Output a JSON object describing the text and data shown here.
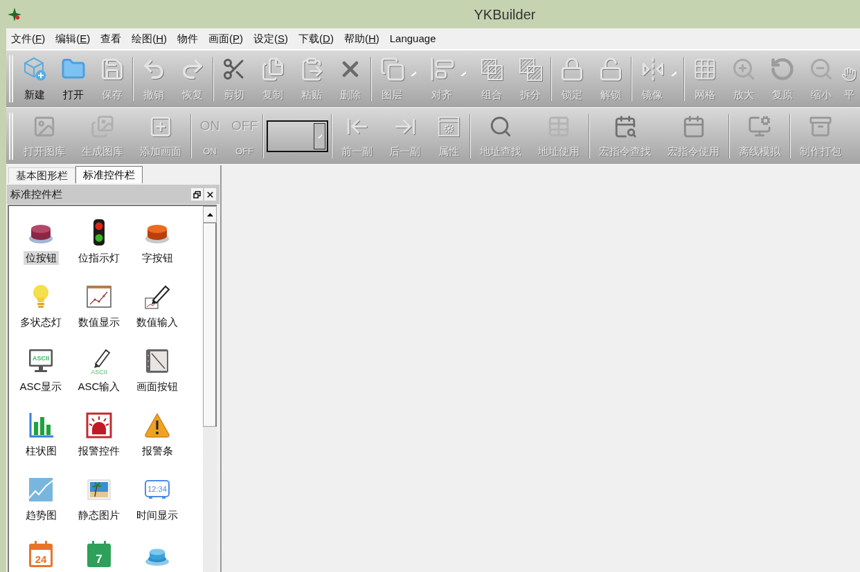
{
  "window": {
    "title": "YKBuilder"
  },
  "menu": [
    {
      "label": "文件(F)",
      "access_key": true
    },
    {
      "label": "编辑(E)",
      "access_key": true
    },
    {
      "label": "查看",
      "access_key": false
    },
    {
      "label": "绘图(H)",
      "access_key": true
    },
    {
      "label": "物件",
      "access_key": false
    },
    {
      "label": "画面(P)",
      "access_key": true
    },
    {
      "label": "设定(S)",
      "access_key": true
    },
    {
      "label": "下载(D)",
      "access_key": true
    },
    {
      "label": "帮助(H)",
      "access_key": true
    },
    {
      "label": "Language",
      "access_key": false
    }
  ],
  "toolbar_1": [
    [
      {
        "label": "新建",
        "disabled": false,
        "dropdown": false
      },
      {
        "label": "打开",
        "disabled": false,
        "dropdown": false
      },
      {
        "label": "保存",
        "disabled": true,
        "dropdown": false
      }
    ],
    [
      {
        "label": "撤销",
        "disabled": true,
        "dropdown": false
      },
      {
        "label": "恢复",
        "disabled": true,
        "dropdown": false
      }
    ],
    [
      {
        "label": "剪切",
        "disabled": true,
        "dropdown": false
      },
      {
        "label": "复制",
        "disabled": true,
        "dropdown": false
      },
      {
        "label": "粘贴",
        "disabled": true,
        "dropdown": false
      },
      {
        "label": "删除",
        "disabled": true,
        "dropdown": false
      }
    ],
    [
      {
        "label": "图层",
        "disabled": true,
        "dropdown": true
      },
      {
        "label": "对齐",
        "disabled": true,
        "dropdown": true
      },
      {
        "label": "组合",
        "disabled": true,
        "dropdown": false
      },
      {
        "label": "拆分",
        "disabled": true,
        "dropdown": false
      }
    ],
    [
      {
        "label": "锁定",
        "disabled": true,
        "dropdown": false
      },
      {
        "label": "解锁",
        "disabled": true,
        "dropdown": false
      }
    ],
    [
      {
        "label": "镜像",
        "disabled": true,
        "dropdown": true
      }
    ],
    [
      {
        "label": "网格",
        "disabled": true,
        "dropdown": false
      },
      {
        "label": "放大",
        "disabled": true,
        "dropdown": false
      },
      {
        "label": "复原",
        "disabled": true,
        "dropdown": false
      },
      {
        "label": "缩小",
        "disabled": true,
        "dropdown": false
      },
      {
        "label": "平",
        "disabled": true,
        "dropdown": false
      }
    ]
  ],
  "toolbar_2": [
    [
      {
        "kind": "button",
        "label": "打开图库",
        "disabled": true
      },
      {
        "kind": "button",
        "label": "生成图库",
        "disabled": true
      },
      {
        "kind": "button",
        "label": "添加画面",
        "disabled": true
      }
    ],
    [
      {
        "kind": "glyph",
        "icon_text": "ON",
        "label": "ON",
        "disabled": true
      },
      {
        "kind": "glyph",
        "icon_text": "OFF",
        "label": "OFF",
        "disabled": true
      }
    ],
    [
      {
        "kind": "combo"
      }
    ],
    [
      {
        "kind": "button",
        "label": "前一副",
        "disabled": true
      },
      {
        "kind": "button",
        "label": "后一副",
        "disabled": true
      },
      {
        "kind": "button",
        "label": "属性",
        "disabled": true
      }
    ],
    [
      {
        "kind": "button",
        "label": "地址查找",
        "disabled": true
      },
      {
        "kind": "button",
        "label": "地址使用",
        "disabled": true
      }
    ],
    [
      {
        "kind": "button",
        "label": "宏指令查找",
        "disabled": true
      },
      {
        "kind": "button",
        "label": "宏指令使用",
        "disabled": true
      }
    ],
    [
      {
        "kind": "button",
        "label": "离线模拟",
        "disabled": true
      }
    ],
    [
      {
        "kind": "button",
        "label": "制作打包",
        "disabled": true
      }
    ]
  ],
  "left_panel": {
    "tabs": [
      {
        "label": "基本图形栏",
        "selected": false
      },
      {
        "label": "标准控件栏",
        "selected": true
      }
    ],
    "title": "标准控件栏",
    "items": [
      {
        "label": "位按钮",
        "selected": true
      },
      {
        "label": "位指示灯",
        "selected": false
      },
      {
        "label": "字按钮",
        "selected": false
      },
      {
        "label": "多状态灯",
        "selected": false
      },
      {
        "label": "数值显示",
        "selected": false
      },
      {
        "label": "数值输入",
        "selected": false
      },
      {
        "label": "ASC显示",
        "icon_text": "ASCII",
        "selected": false
      },
      {
        "label": "ASC输入",
        "icon_text": "ASCII",
        "selected": false
      },
      {
        "label": "画面按钮",
        "selected": false
      },
      {
        "label": "柱状图",
        "selected": false
      },
      {
        "label": "报警控件",
        "selected": false
      },
      {
        "label": "报警条",
        "selected": false
      },
      {
        "label": "趋势图",
        "selected": false
      },
      {
        "label": "静态图片",
        "selected": false
      },
      {
        "label": "时间显示",
        "icon_text": "12:34",
        "selected": false
      },
      {
        "icon_text": "24",
        "selected": false
      },
      {
        "icon_text": "7",
        "selected": false
      },
      {
        "selected": false
      }
    ]
  }
}
